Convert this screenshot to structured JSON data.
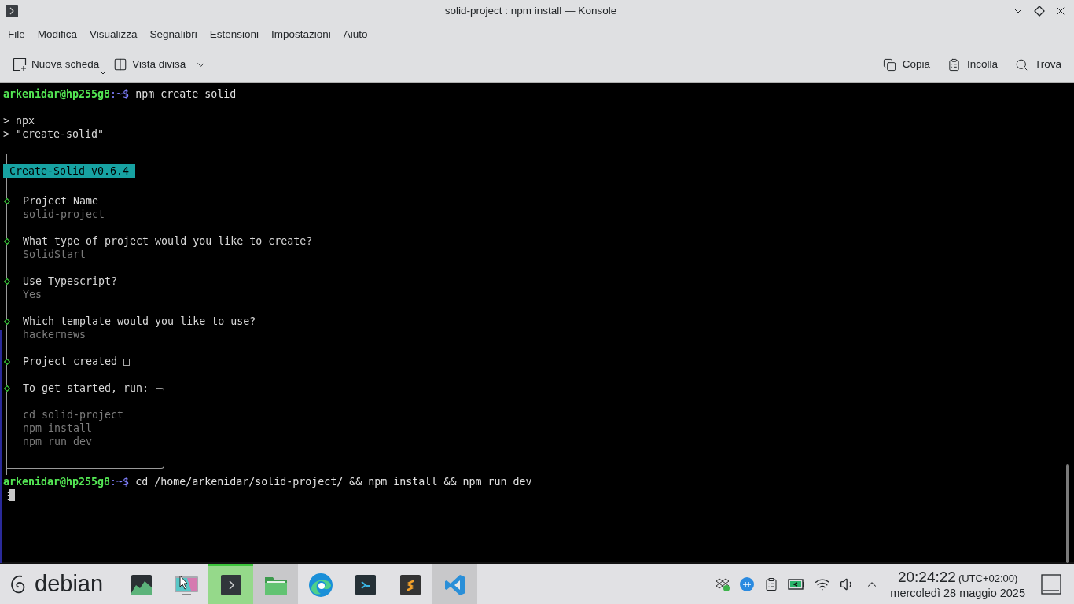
{
  "window": {
    "title": "solid-project : npm install — Konsole"
  },
  "menu": [
    "File",
    "Modifica",
    "Visualizza",
    "Segnalibri",
    "Estensioni",
    "Impostazioni",
    "Aiuto"
  ],
  "toolbar": {
    "left": [
      {
        "label": "Nuova scheda"
      },
      {
        "label": "Vista divisa"
      }
    ],
    "right": [
      {
        "label": "Copia"
      },
      {
        "label": "Incolla"
      },
      {
        "label": "Trova"
      }
    ]
  },
  "terminal": {
    "before": [
      {
        "kind": "prompt",
        "user": "arkenidar@hp255g8",
        "path": ":~$",
        "command": "npm create solid"
      },
      {
        "kind": "blank"
      },
      {
        "kind": "output",
        "text": "> npx"
      },
      {
        "kind": "output",
        "text": "> \"create-solid\""
      },
      {
        "kind": "blank"
      }
    ],
    "wizard": {
      "badge": "Create-Solid v0.6.4",
      "steps": [
        {
          "kind": "question",
          "title": "Project Name",
          "answer": "solid-project"
        },
        {
          "kind": "question",
          "title": "What type of project would you like to create?",
          "answer": "SolidStart"
        },
        {
          "kind": "question",
          "title": "Use Typescript?",
          "answer": "Yes"
        },
        {
          "kind": "question",
          "title": "Which template would you like to use?",
          "answer": "hackernews"
        },
        {
          "kind": "status",
          "title": "Project created □"
        },
        {
          "kind": "note",
          "title": "To get started, run:",
          "commands": [
            "cd solid-project",
            "npm install",
            "npm run dev"
          ]
        }
      ]
    },
    "after": [
      {
        "kind": "prompt",
        "user": "arkenidar@hp255g8",
        "path": ":~$",
        "command": "cd /home/arkenidar/solid-project/ && npm install && npm run dev"
      },
      {
        "kind": "cursor",
        "text": "⋮"
      }
    ]
  },
  "taskbar": {
    "launcher": "debian",
    "tasks": [
      {
        "active": false,
        "open": false
      },
      {
        "active": false,
        "open": false
      },
      {
        "active": true,
        "open": true
      },
      {
        "active": false,
        "open": true
      },
      {
        "active": false,
        "open": false
      },
      {
        "active": false,
        "open": false
      },
      {
        "active": false,
        "open": false
      },
      {
        "active": false,
        "open": true
      }
    ],
    "clock": {
      "time": "20:24:22",
      "timezone": "(UTC+02:00)",
      "date": "mercoledì 28 maggio 2025"
    }
  }
}
